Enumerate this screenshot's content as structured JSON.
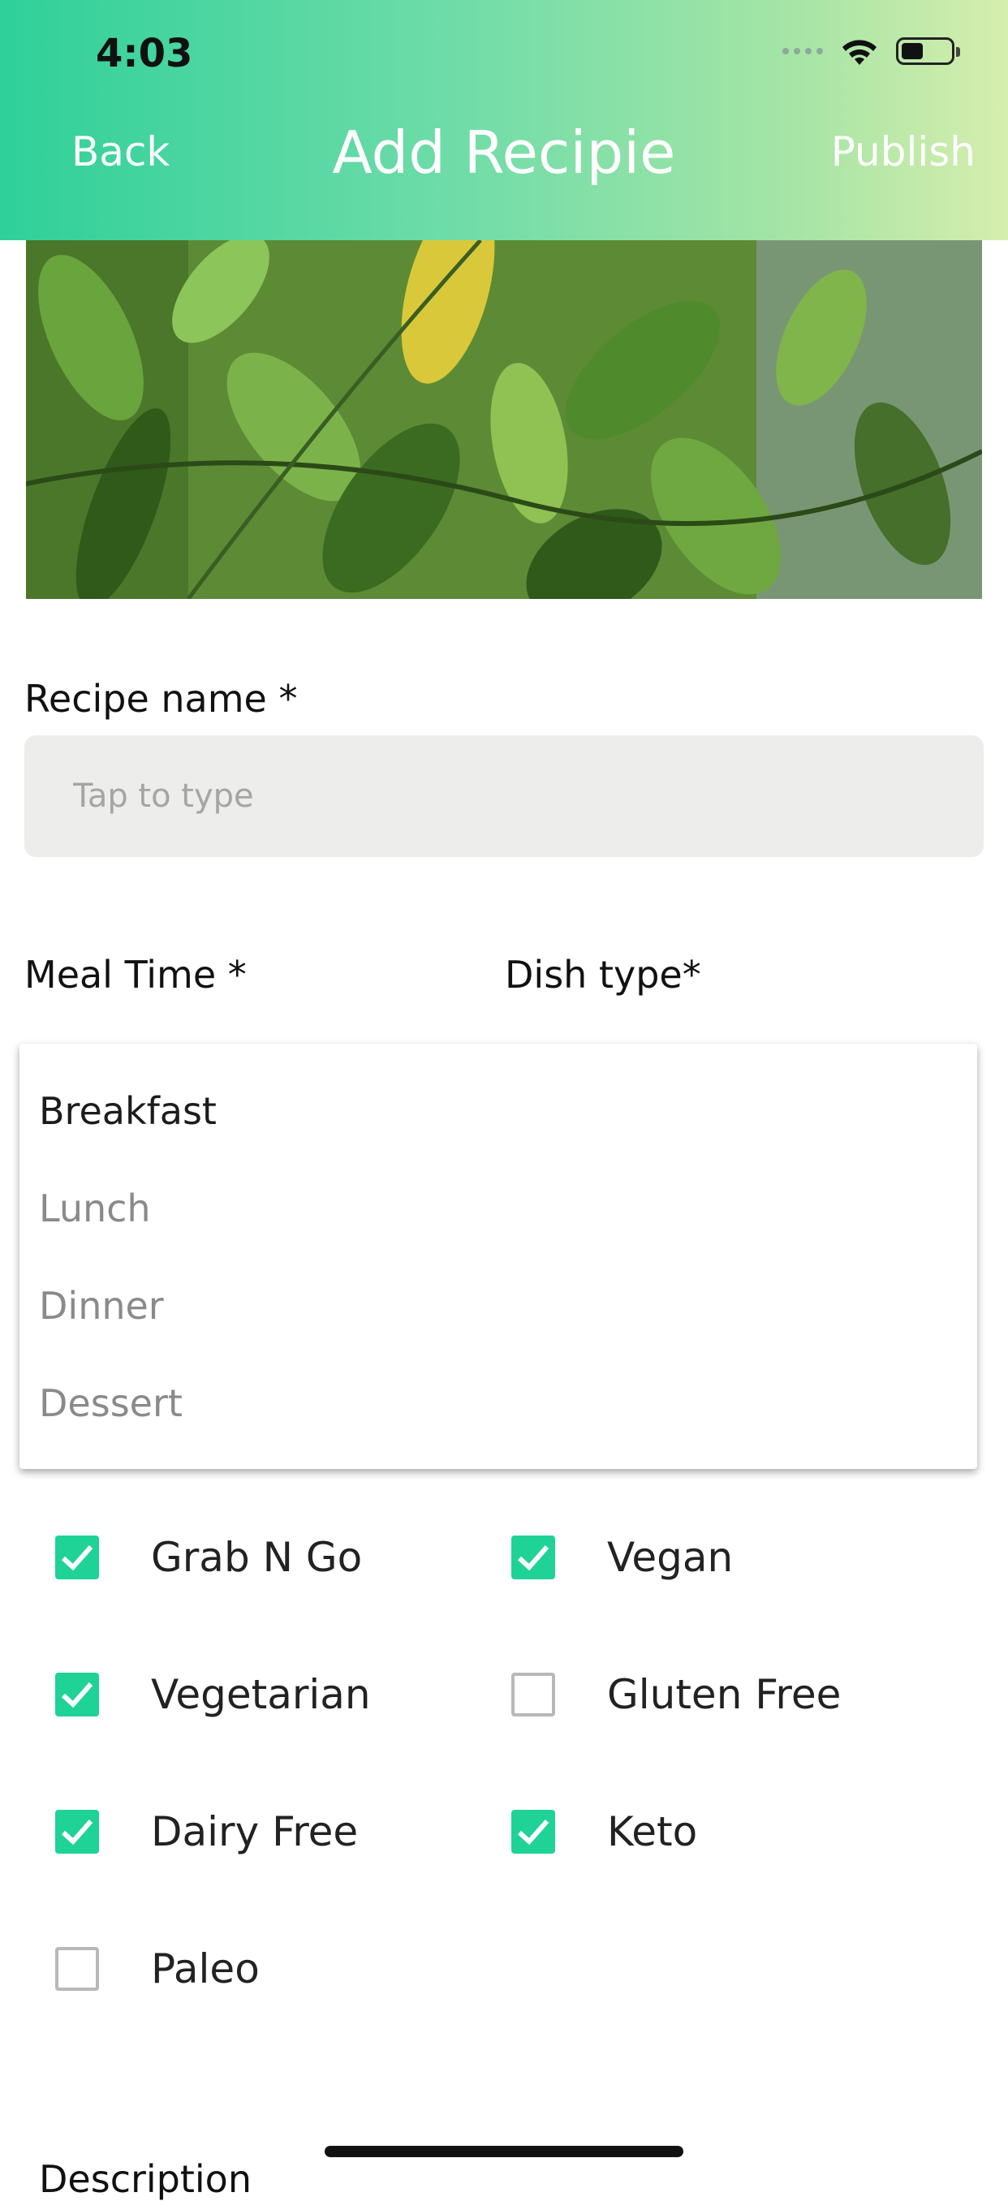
{
  "status": {
    "time": "4:03"
  },
  "header": {
    "back_label": "Back",
    "title": "Add Recipie",
    "publish_label": "Publish"
  },
  "recipe_name": {
    "label": "Recipe name *",
    "placeholder": "Tap to type"
  },
  "meal_time": {
    "label": "Meal Time *"
  },
  "dish_type": {
    "label": "Dish type*"
  },
  "dropdown": {
    "options": [
      "Breakfast",
      "Lunch",
      "Dinner",
      "Dessert"
    ],
    "selected": "Breakfast"
  },
  "checkboxes": [
    {
      "label": "Grab N Go",
      "checked": true
    },
    {
      "label": "Vegan",
      "checked": true
    },
    {
      "label": "Vegetarian",
      "checked": true
    },
    {
      "label": "Gluten Free",
      "checked": false
    },
    {
      "label": "Dairy Free",
      "checked": true
    },
    {
      "label": "Keto",
      "checked": true
    },
    {
      "label": "Paleo",
      "checked": false
    }
  ],
  "description": {
    "label": "Description"
  },
  "colors": {
    "accent": "#1fd296",
    "header_start": "#2fd09a",
    "header_end": "#d6eeae"
  },
  "icons": [
    "wifi-icon",
    "battery-icon",
    "check-icon"
  ]
}
